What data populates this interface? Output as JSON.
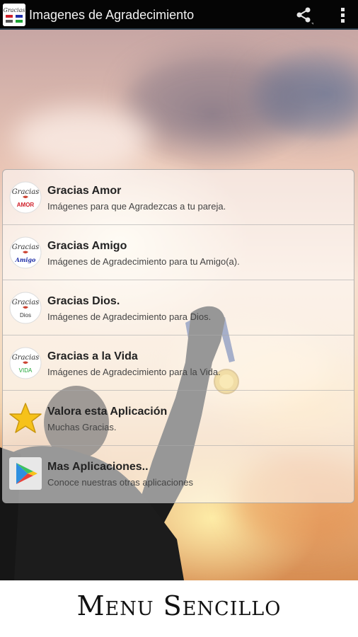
{
  "app": {
    "title": "Imagenes de Agradecimiento",
    "icon": "gracias-app-icon"
  },
  "actionbar": {
    "share_icon": "share-icon",
    "overflow_icon": "overflow-menu-icon"
  },
  "menu": {
    "items": [
      {
        "title": "Gracias Amor",
        "subtitle": "Imágenes para que Agradezcas a tu pareja.",
        "icon": "gracias-amor-icon",
        "badge": "AMOR",
        "badge_color": "#d0202a"
      },
      {
        "title": "Gracias Amigo",
        "subtitle": "Imágenes de Agradecimiento para tu Amigo(a).",
        "icon": "gracias-amigo-icon",
        "badge": "Amigo",
        "badge_color": "#1f2fa8"
      },
      {
        "title": "Gracias Dios.",
        "subtitle": "Imágenes de Agradecimiento para Dios.",
        "icon": "gracias-dios-icon",
        "badge": "Dios",
        "badge_color": "#333333"
      },
      {
        "title": "Gracias a la Vida",
        "subtitle": "Imágenes de Agradecimiento para la Vida.",
        "icon": "gracias-vida-icon",
        "badge": "VIDA",
        "badge_color": "#1ea535"
      },
      {
        "title": "Valora esta Aplicación",
        "subtitle": "Muchas Gracias.",
        "icon": "star-icon"
      },
      {
        "title": "Mas Aplicaciones..",
        "subtitle": "Conoce nuestras otras aplicaciones",
        "icon": "play-store-icon"
      }
    ],
    "icon_script_text": "Gracias"
  },
  "footer": {
    "caption": "Menu Sencillo"
  },
  "colors": {
    "actionbar": "#050505",
    "star": "#f6c21a",
    "play_green": "#3ec15f",
    "play_blue": "#2d8fe0",
    "play_red": "#e8413a",
    "play_yellow": "#f7c31c"
  }
}
